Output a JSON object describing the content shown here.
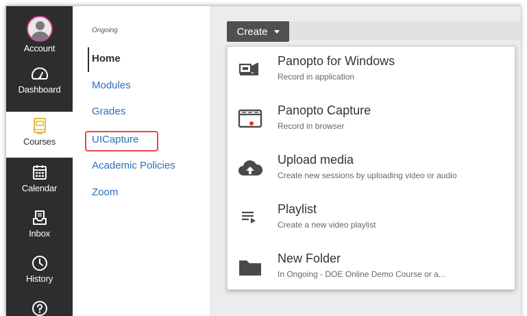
{
  "global_nav": {
    "items": [
      {
        "label": "Account",
        "icon": "avatar-icon"
      },
      {
        "label": "Dashboard",
        "icon": "dashboard-icon"
      },
      {
        "label": "Courses",
        "icon": "courses-icon"
      },
      {
        "label": "Calendar",
        "icon": "calendar-icon"
      },
      {
        "label": "Inbox",
        "icon": "inbox-icon"
      },
      {
        "label": "History",
        "icon": "history-icon"
      },
      {
        "label": "",
        "icon": "help-icon"
      }
    ]
  },
  "course_nav": {
    "term": "Ongoing",
    "links": [
      {
        "label": "Home"
      },
      {
        "label": "Modules"
      },
      {
        "label": "Grades"
      },
      {
        "label": "UICapture"
      },
      {
        "label": "Academic Policies"
      },
      {
        "label": "Zoom"
      }
    ]
  },
  "create_button": {
    "label": "Create"
  },
  "create_menu": {
    "items": [
      {
        "title": "Panopto for Windows",
        "subtitle": "Record in application",
        "icon": "video-camera-icon"
      },
      {
        "title": "Panopto Capture",
        "subtitle": "Record in browser",
        "icon": "browser-record-icon"
      },
      {
        "title": "Upload media",
        "subtitle": "Create new sessions by uploading video or audio",
        "icon": "cloud-upload-icon"
      },
      {
        "title": "Playlist",
        "subtitle": "Create a new video playlist",
        "icon": "playlist-icon"
      },
      {
        "title": "New Folder",
        "subtitle": "In Ongoing - DOE Online Demo Course or a...",
        "icon": "folder-icon"
      }
    ]
  },
  "colors": {
    "global_nav_bg": "#2d2d2d",
    "avatar_ring": "#d63a93",
    "courses_icon": "#e8b73a",
    "link": "#2a6ebb",
    "highlight": "#e8474b",
    "record_dot": "#e0322f"
  }
}
